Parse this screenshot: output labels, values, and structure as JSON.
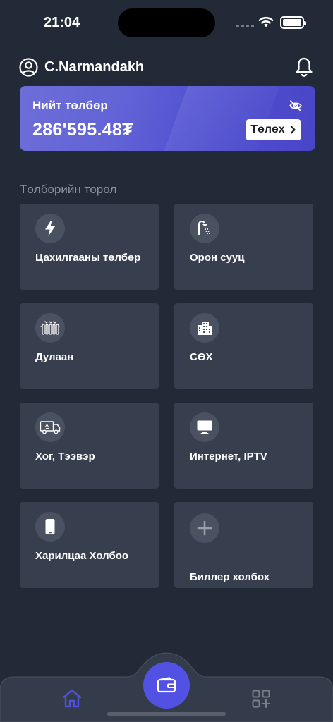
{
  "status_bar": {
    "time": "21:04"
  },
  "header": {
    "user_name": "C.Narmandakh"
  },
  "balance": {
    "label": "Нийт төлбөр",
    "amount": "286'595.48₮",
    "pay_label": "Төлөх"
  },
  "section_title": "Төлбөрийн төрөл",
  "categories": [
    {
      "label": "Цахилгааны төлбөр",
      "icon": "lightning-icon"
    },
    {
      "label": "Орон сууц",
      "icon": "shower-icon"
    },
    {
      "label": "Дулаан",
      "icon": "radiator-icon"
    },
    {
      "label": "СӨХ",
      "icon": "building-icon"
    },
    {
      "label": "Хог, Тээвэр",
      "icon": "truck-recycle-icon"
    },
    {
      "label": "Интернет, IPTV",
      "icon": "monitor-icon"
    },
    {
      "label": "Харилцаа Холбоо",
      "icon": "phone-icon"
    },
    {
      "label": "Биллер холбох",
      "icon": "plus-icon"
    }
  ],
  "colors": {
    "background": "#222a37",
    "tile": "#373f4f",
    "accent": "#5152e4",
    "card_gradient_start": "#6d6ed8",
    "card_gradient_end": "#4845c7"
  }
}
